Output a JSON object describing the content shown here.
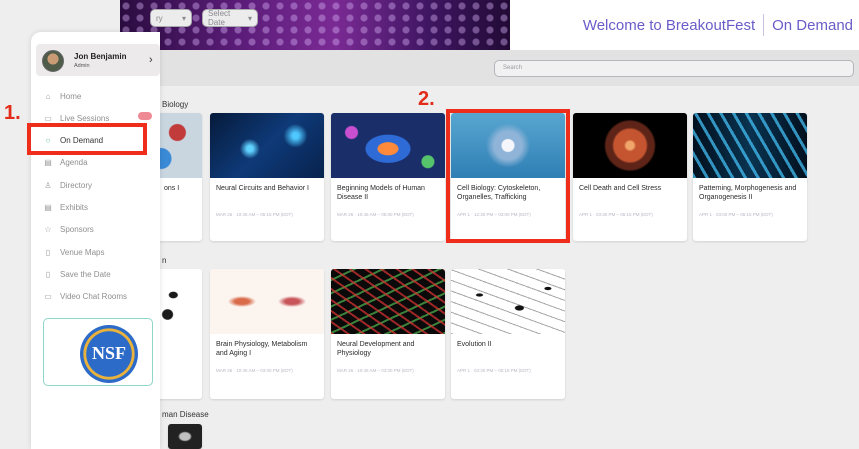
{
  "header": {
    "welcome": "Welcome to BreakoutFest",
    "on_demand": "On Demand"
  },
  "filters": {
    "dropdown1_partial": "ry",
    "select_date": "Select Date",
    "search_placeholder": "Search"
  },
  "user": {
    "name": "Jon Benjamin",
    "role": "Admin"
  },
  "nav": [
    {
      "label": "Home",
      "icon": "home-icon",
      "glyph": "⌂"
    },
    {
      "label": "Live Sessions",
      "icon": "video-icon",
      "glyph": "▭"
    },
    {
      "label": "On Demand",
      "icon": "chat-bubble-icon",
      "glyph": "○"
    },
    {
      "label": "Agenda",
      "icon": "calendar-icon",
      "glyph": "▤"
    },
    {
      "label": "Directory",
      "icon": "people-icon",
      "glyph": "♙"
    },
    {
      "label": "Exhibits",
      "icon": "exhibits-icon",
      "glyph": "▤"
    },
    {
      "label": "Sponsors",
      "icon": "star-icon",
      "glyph": "☆"
    },
    {
      "label": "Venue Maps",
      "icon": "document-icon",
      "glyph": "▯"
    },
    {
      "label": "Save the Date",
      "icon": "document-icon",
      "glyph": "▯"
    },
    {
      "label": "Video Chat Rooms",
      "icon": "chat-icon",
      "glyph": "▭"
    }
  ],
  "sponsor_logo": "NSF",
  "sections": [
    "Biology",
    "n",
    "man Disease"
  ],
  "row1_cards": [
    {
      "title": "ons I",
      "time": ""
    },
    {
      "title": "Neural Circuits and Behavior I",
      "time": "MAR 26 · 10:45 AM – 05:15 PM (EDT)"
    },
    {
      "title": "Beginning Models of Human Disease II",
      "time": "MAR 26 · 10:45 AM – 05:00 PM (EDT)"
    },
    {
      "title": "Cell Biology: Cytoskeleton, Organelles, Trafficking",
      "time": "APR 1 · 12:30 PM – 03:00 PM (EDT)"
    },
    {
      "title": "Cell Death and Cell Stress",
      "time": "APR 1 · 03:30 PM – 06:15 PM (EDT)"
    },
    {
      "title": "Patterning, Morphogenesis and Organogenesis II",
      "time": "APR 1 · 03:00 PM – 06:15 PM (EDT)"
    }
  ],
  "row2_cards": [
    {
      "title": "",
      "time": ""
    },
    {
      "title": "Brain Physiology, Metabolism and Aging I",
      "time": "MAR 26 · 10:45 AM – 03:00 PM (EDT)"
    },
    {
      "title": "Neural Development and Physiology",
      "time": "MAR 26 · 10:45 AM – 03:00 PM (EDT)"
    },
    {
      "title": "Evolution II",
      "time": "APR 1 · 03:30 PM – 05:15 PM (EDT)"
    }
  ],
  "annotations": {
    "step1": "1.",
    "step2": "2."
  },
  "colors": {
    "accent": "#6a5cc8",
    "annotation": "#ee2d1b",
    "active_icon": "#5fb8a3"
  }
}
